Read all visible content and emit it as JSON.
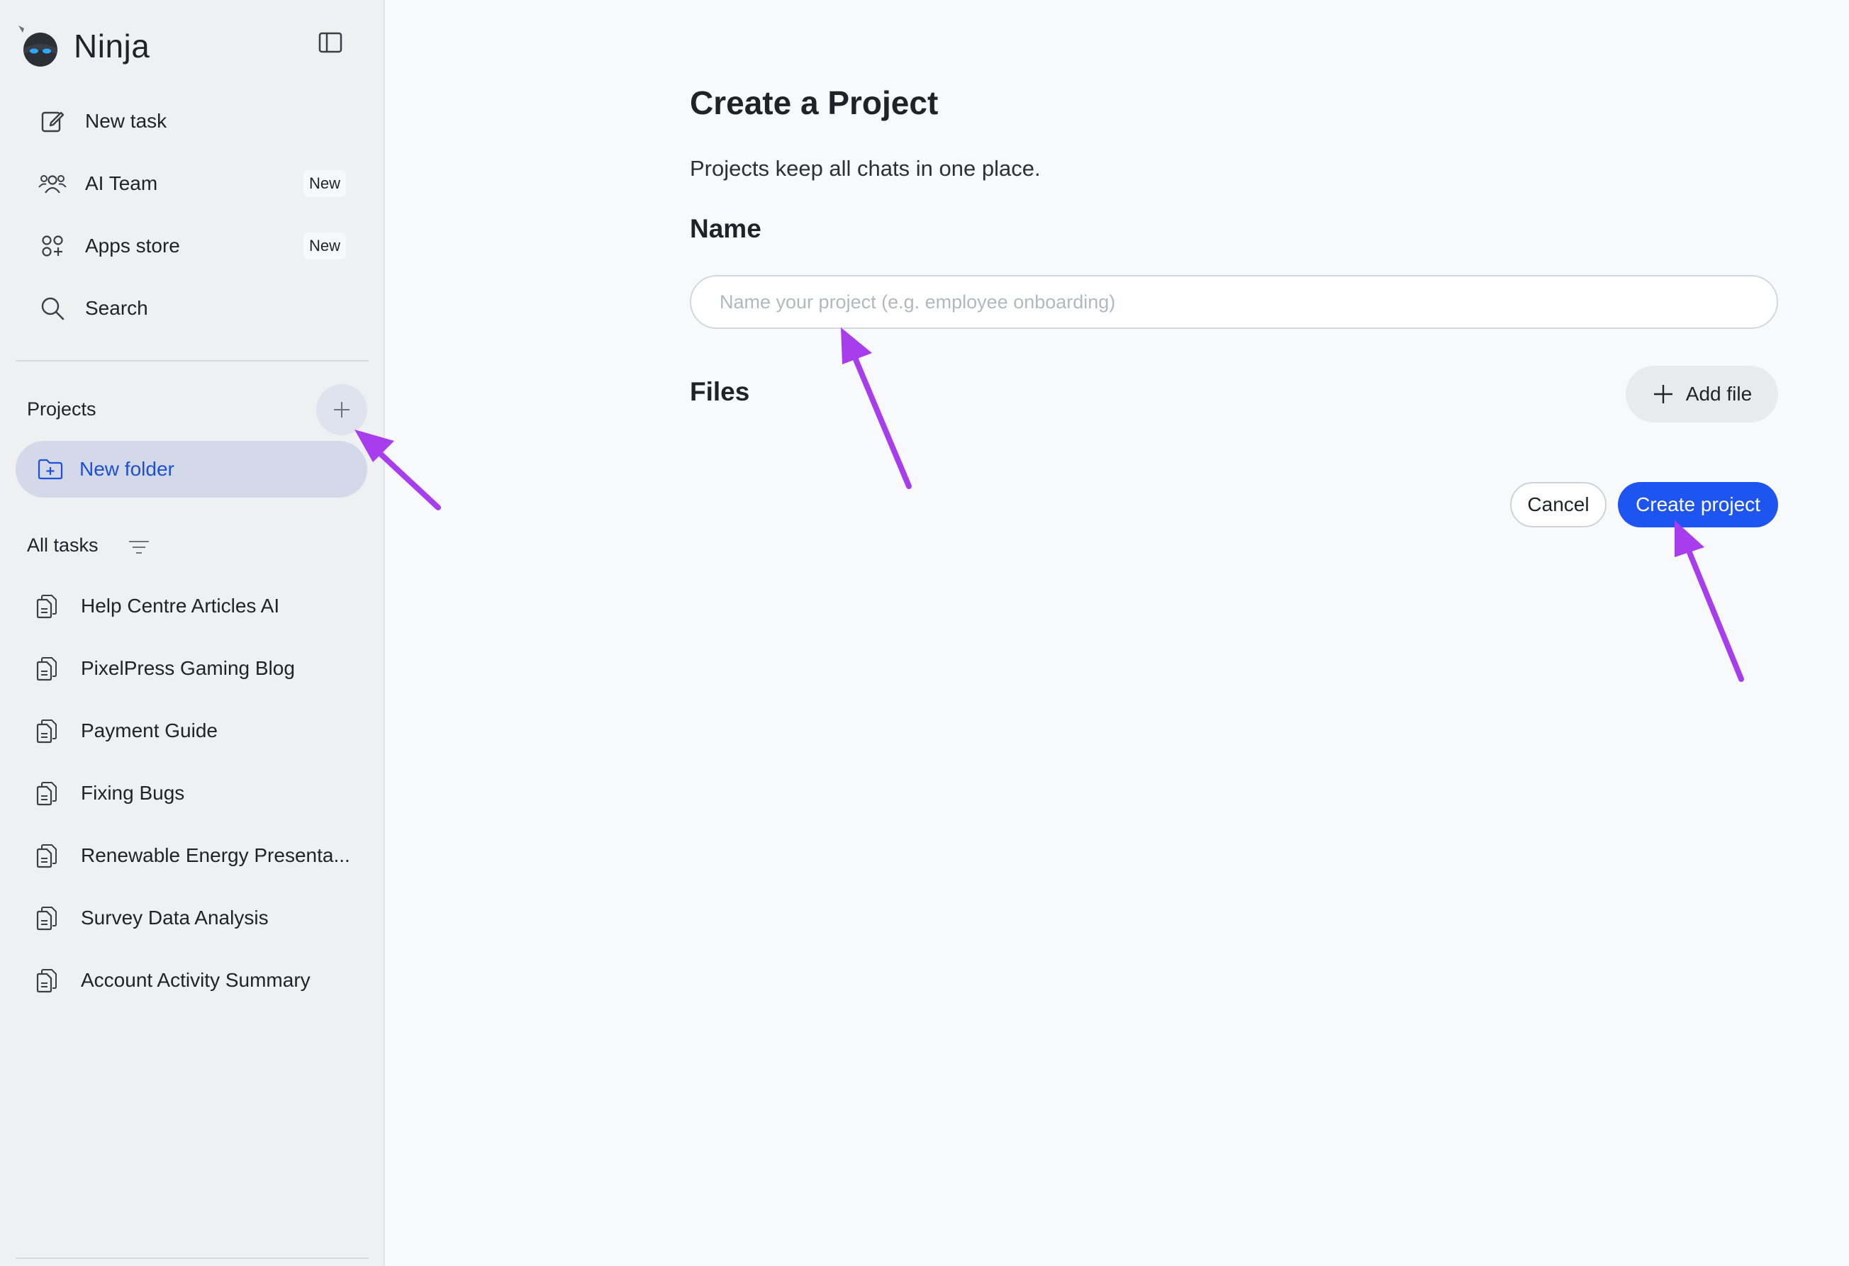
{
  "app": {
    "brand": "Ninja"
  },
  "sidebar": {
    "nav": [
      {
        "label": "New task",
        "icon": "edit-icon"
      },
      {
        "label": "AI Team",
        "icon": "team-icon",
        "badge": "New"
      },
      {
        "label": "Apps store",
        "icon": "apps-icon",
        "badge": "New"
      },
      {
        "label": "Search",
        "icon": "search-icon"
      }
    ],
    "projects_label": "Projects",
    "folder": {
      "label": "New folder",
      "icon": "folder-add-icon"
    },
    "all_tasks_label": "All tasks",
    "tasks": [
      "Help Centre Articles AI",
      "PixelPress Gaming Blog",
      "Payment Guide",
      "Fixing Bugs",
      "Renewable Energy Presenta...",
      "Survey Data Analysis",
      "Account Activity Summary"
    ]
  },
  "main": {
    "title": "Create a Project",
    "subtitle": "Projects keep all chats in one place.",
    "name_label": "Name",
    "name_placeholder": "Name your project (e.g. employee onboarding)",
    "name_value": "",
    "files_label": "Files",
    "add_file_label": "Add file",
    "cancel_label": "Cancel",
    "create_label": "Create project"
  },
  "colors": {
    "accent": "#1e55f0",
    "annotation_arrow": "#a73ded",
    "folder_highlight": "#d3d9e8"
  }
}
